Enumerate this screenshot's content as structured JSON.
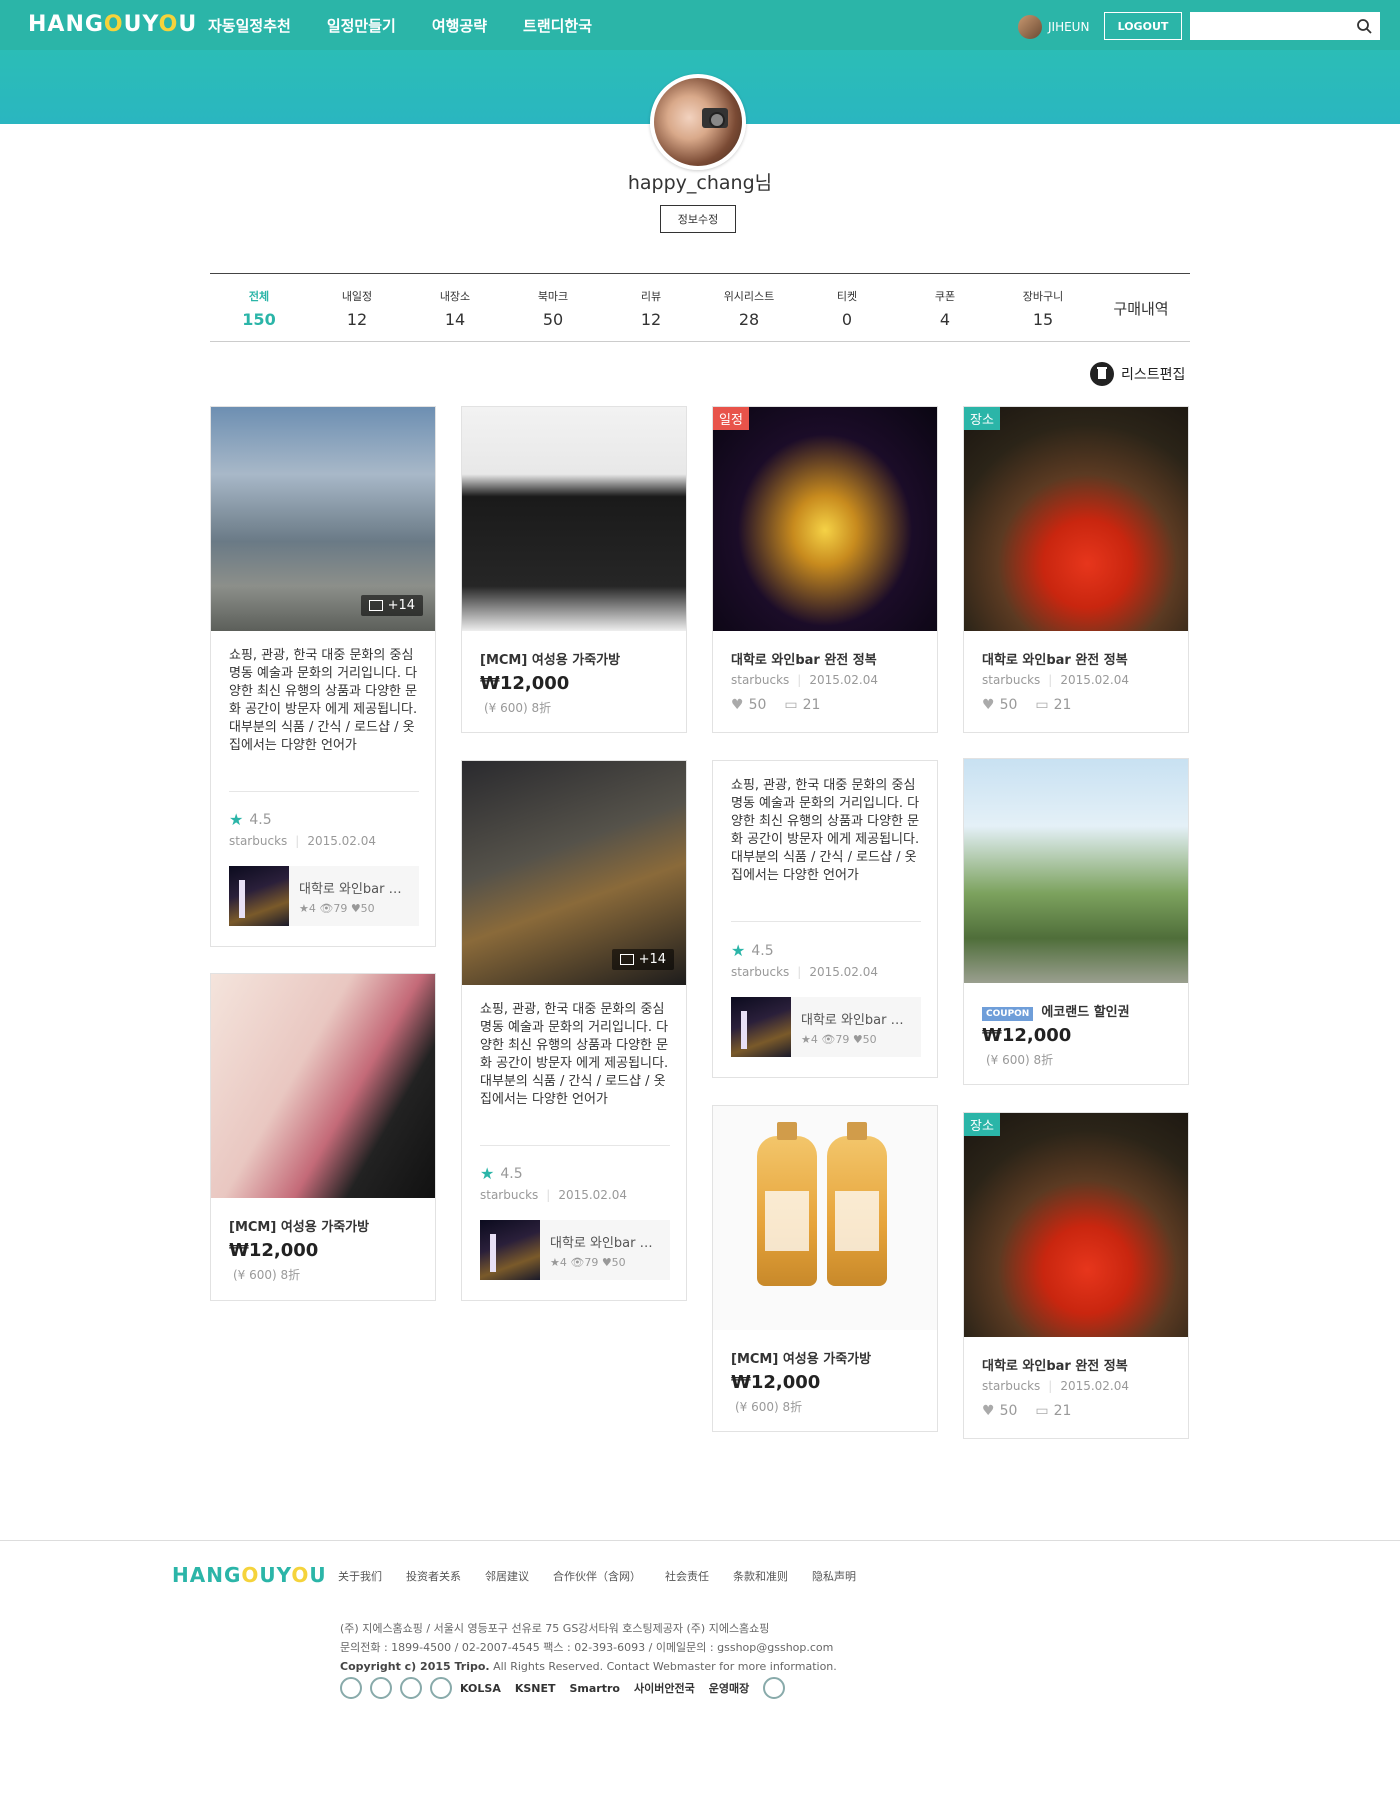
{
  "header": {
    "logo": "HANGOUYOU",
    "nav": [
      "자동일정추천",
      "일정만들기",
      "여행공략",
      "트랜디한국"
    ],
    "user_name": "JIHEUN",
    "logout_label": "LOGOUT",
    "search_placeholder": ""
  },
  "profile": {
    "username": "happy_chang님",
    "edit_label": "정보수정"
  },
  "tabs": [
    {
      "label": "전체",
      "count": "150"
    },
    {
      "label": "내일정",
      "count": "12"
    },
    {
      "label": "내장소",
      "count": "14"
    },
    {
      "label": "북마크",
      "count": "50"
    },
    {
      "label": "리뷰",
      "count": "12"
    },
    {
      "label": "위시리스트",
      "count": "28"
    },
    {
      "label": "티켓",
      "count": "0"
    },
    {
      "label": "쿠폰",
      "count": "4"
    },
    {
      "label": "장바구니",
      "count": "15"
    },
    {
      "label": "구매내역",
      "count": ""
    }
  ],
  "list_edit_label": "리스트편집",
  "review_text": "쇼핑, 관광, 한국 대중 문화의 중심 명동 예술과 문화의 거리입니다. 다양한 최신 유행의 상품과 다양한 문화 공간이 방문자 에게 제공됩니다. 대부분의 식품 / 간식 / 로드샵 / 옷집에서는 다양한 언어가",
  "cards": {
    "c1": {
      "photo_count": "+14",
      "rating": "4.5",
      "author": "starbucks",
      "date": "2015.02.04",
      "mini_title": "대학로 와인bar 완전 정복",
      "mini_stats": "★4  👁79  ♥50"
    },
    "c2": {
      "title": "[MCM] 여성용 가죽가방",
      "price": "₩12,000",
      "sub": "(¥ 600) 8折"
    },
    "c3": {
      "badge": "일정",
      "title": "대학로 와인bar 완전 정복",
      "author": "starbucks",
      "date": "2015.02.04",
      "likes": "50",
      "comments": "21"
    },
    "c4": {
      "badge": "장소",
      "title": "대학로 와인bar 완전 정복",
      "author": "starbucks",
      "date": "2015.02.04",
      "likes": "50",
      "comments": "21"
    },
    "c5": {
      "title": "[MCM] 여성용 가죽가방",
      "price": "₩12,000",
      "sub": "(¥ 600) 8折"
    },
    "c6": {
      "photo_count": "+14",
      "rating": "4.5",
      "author": "starbucks",
      "date": "2015.02.04",
      "mini_title": "대학로 와인bar 완전 정복",
      "mini_stats": "★4  👁79  ♥50"
    },
    "c7": {
      "rating": "4.5",
      "author": "starbucks",
      "date": "2015.02.04",
      "mini_title": "대학로 와인bar 완전 정복",
      "mini_stats": "★4  👁79  ♥50"
    },
    "c8": {
      "coupon": "COUPON",
      "title": "에코랜드 할인권",
      "price": "₩12,000",
      "sub": "(¥ 600) 8折"
    },
    "c9": {
      "title": "[MCM] 여성용 가죽가방",
      "price": "₩12,000",
      "sub": "(¥ 600) 8折"
    },
    "c10": {
      "badge": "장소",
      "title": "대학로 와인bar 완전 정복",
      "author": "starbucks",
      "date": "2015.02.04",
      "likes": "50",
      "comments": "21"
    }
  },
  "footer": {
    "logo": "HANGOUYOU",
    "links": [
      "关于我们",
      "投资者关系",
      "邻居建议",
      "合作伙伴（含网）",
      "社会责任",
      "条款和准则",
      "隐私声明"
    ],
    "line1": "(주) 지에스홈쇼핑  / 서울시 영등포구 선유로 75 GS강서타워 호스팅제공자 (주) 지에스홈쇼핑",
    "line2": "문의전화 : 1899-4500 / 02-2007-4545 팩스 : 02-393-6093 / 이메일문의 : gsshop@gsshop.com",
    "copyright_bold": "Copyright c) 2015 Tripo.",
    "copyright_rest": " All Rights Reserved. Contact Webmaster for more information.",
    "badges": [
      "KOLSA",
      "KSNET",
      "Smartro",
      "사이버안전국",
      "운영매장"
    ]
  }
}
